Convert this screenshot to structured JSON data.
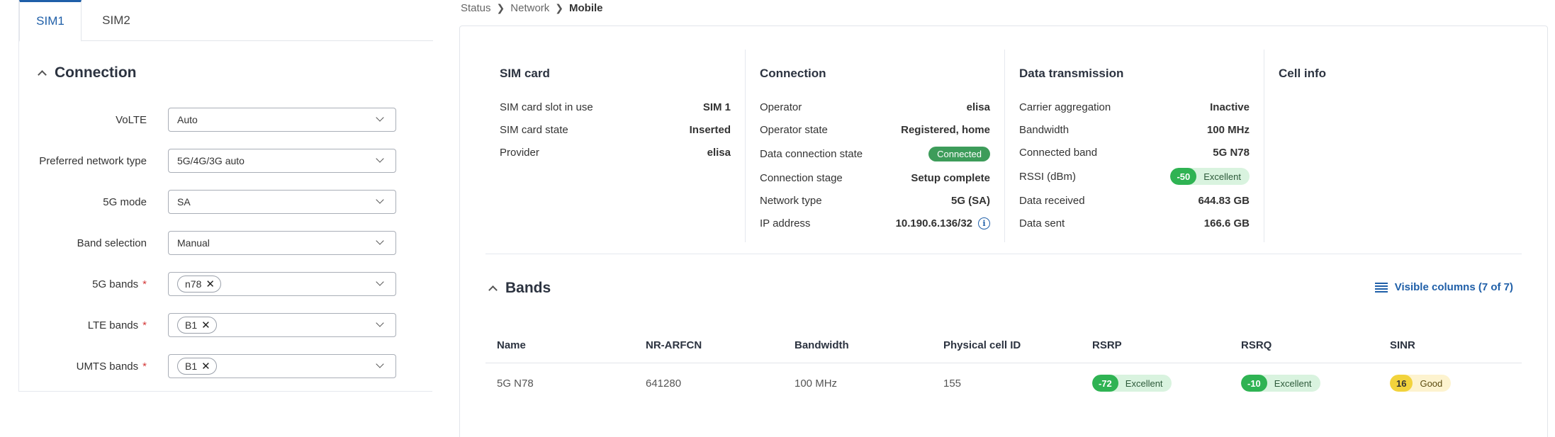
{
  "tabs": [
    {
      "label": "SIM1",
      "active": true
    },
    {
      "label": "SIM2",
      "active": false
    }
  ],
  "connection_section": {
    "title": "Connection",
    "fields": [
      {
        "label": "VoLTE",
        "required": false,
        "value": "Auto"
      },
      {
        "label": "Preferred network type",
        "required": false,
        "value": "5G/4G/3G auto"
      },
      {
        "label": "5G mode",
        "required": false,
        "value": "SA"
      },
      {
        "label": "Band selection",
        "required": false,
        "value": "Manual"
      },
      {
        "label": "5G bands",
        "required": true,
        "chips": [
          "n78"
        ]
      },
      {
        "label": "LTE bands",
        "required": true,
        "chips": [
          "B1"
        ]
      },
      {
        "label": "UMTS bands",
        "required": true,
        "chips": [
          "B1"
        ]
      }
    ]
  },
  "breadcrumb": {
    "items": [
      "Status",
      "Network"
    ],
    "current": "Mobile"
  },
  "sim_card": {
    "title": "SIM card",
    "rows": [
      {
        "key": "SIM card slot in use",
        "value": "SIM 1"
      },
      {
        "key": "SIM card state",
        "value": "Inserted"
      },
      {
        "key": "Provider",
        "value": "elisa"
      }
    ]
  },
  "connection_info": {
    "title": "Connection",
    "rows": [
      {
        "key": "Operator",
        "value": "elisa"
      },
      {
        "key": "Operator state",
        "value": "Registered, home"
      },
      {
        "key": "Data connection state",
        "value": "Connected",
        "badge": true
      },
      {
        "key": "Connection stage",
        "value": "Setup complete"
      },
      {
        "key": "Network type",
        "value": "5G (SA)"
      },
      {
        "key": "IP address",
        "value": "10.190.6.136/32",
        "info_icon": true
      }
    ]
  },
  "data_transmission": {
    "title": "Data transmission",
    "rows": [
      {
        "key": "Carrier aggregation",
        "value": "Inactive"
      },
      {
        "key": "Bandwidth",
        "value": "100 MHz"
      },
      {
        "key": "Connected band",
        "value": "5G N78"
      },
      {
        "key": "RSSI (dBm)",
        "pill": {
          "num": "-50",
          "text": "Excellent",
          "color": "green"
        }
      },
      {
        "key": "Data received",
        "value": "644.83 GB"
      },
      {
        "key": "Data sent",
        "value": "166.6 GB"
      }
    ]
  },
  "cell_info": {
    "title": "Cell info"
  },
  "bands": {
    "title": "Bands",
    "visible_columns_label": "Visible columns (7 of 7)",
    "columns": [
      "Name",
      "NR-ARFCN",
      "Bandwidth",
      "Physical cell ID",
      "RSRP",
      "RSRQ",
      "SINR"
    ],
    "rows": [
      {
        "name": "5G N78",
        "nr_arfcn": "641280",
        "bandwidth": "100 MHz",
        "pci": "155",
        "rsrp": {
          "num": "-72",
          "text": "Excellent",
          "color": "green"
        },
        "rsrq": {
          "num": "-10",
          "text": "Excellent",
          "color": "green"
        },
        "sinr": {
          "num": "16",
          "text": "Good",
          "color": "yellow"
        }
      }
    ]
  },
  "colors": {
    "accent": "#1f5fa8",
    "success": "#2fb353",
    "connected_badge": "#3d9c5a",
    "warning": "#f2d33c",
    "required": "#d43a3a"
  }
}
